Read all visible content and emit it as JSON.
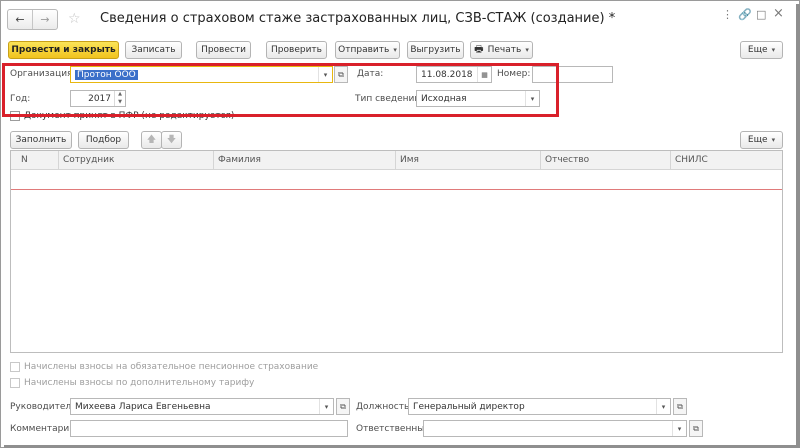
{
  "window": {
    "title": "Сведения о страховом стаже застрахованных лиц, СЗВ-СТАЖ (создание) *",
    "nav_back": "←",
    "nav_forward": "→",
    "star": "☆",
    "menu_icon": "⋮",
    "link_icon": "🔗",
    "maximize_icon": "□",
    "close_icon": "×"
  },
  "toolbar": {
    "post_close": "Провести и закрыть",
    "save": "Записать",
    "post": "Провести",
    "check": "Проверить",
    "send": "Отправить",
    "export": "Выгрузить",
    "print": "Печать",
    "more": "Еще"
  },
  "header": {
    "org_label": "Организация:",
    "org_value": "Протон ООО",
    "date_label": "Дата:",
    "date_value": "11.08.2018",
    "number_label": "Номер:",
    "number_value": "",
    "year_label": "Год:",
    "year_value": "2017",
    "info_type_label": "Тип сведений:",
    "info_type_value": "Исходная",
    "accepted_check": "Документ принят в ПФР (не редактируется)"
  },
  "table_toolbar": {
    "fill": "Заполнить",
    "select": "Подбор",
    "up": "🡅",
    "down": "🡇",
    "more": "Еще"
  },
  "table": {
    "columns": [
      "N",
      "Сотрудник",
      "Фамилия",
      "Имя",
      "Отчество",
      "СНИЛС"
    ]
  },
  "footer": {
    "check_pension": "Начислены взносы на обязательное пенсионное страхование",
    "check_additional": "Начислены взносы по дополнительному тарифу",
    "head_label": "Руководитель:",
    "head_value": "Михеева Лариса Евгеньевна",
    "position_label": "Должность:",
    "position_value": "Генеральный директор",
    "comment_label": "Комментарий:",
    "comment_value": "",
    "responsible_label": "Ответственный:",
    "responsible_value": ""
  }
}
